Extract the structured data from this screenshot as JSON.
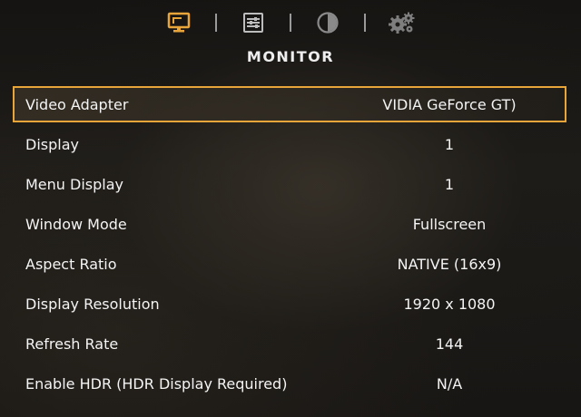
{
  "tabs": [
    {
      "id": "monitor",
      "icon": "monitor-icon",
      "active": true
    },
    {
      "id": "sliders",
      "icon": "sliders-icon",
      "active": false
    },
    {
      "id": "contrast",
      "icon": "contrast-icon",
      "active": false
    },
    {
      "id": "gears",
      "icon": "gears-icon",
      "active": false
    }
  ],
  "colors": {
    "accent": "#e8a63a",
    "inactive_icon": "#8a8a8a",
    "text": "#f4f4f4"
  },
  "page": {
    "title": "MONITOR"
  },
  "settings": [
    {
      "label": "Video Adapter",
      "value": "VIDIA GeForce GT)",
      "selected": true
    },
    {
      "label": "Display",
      "value": "1",
      "selected": false
    },
    {
      "label": "Menu Display",
      "value": "1",
      "selected": false
    },
    {
      "label": "Window Mode",
      "value": "Fullscreen",
      "selected": false
    },
    {
      "label": "Aspect Ratio",
      "value": "NATIVE (16x9)",
      "selected": false
    },
    {
      "label": "Display Resolution",
      "value": "1920 x 1080",
      "selected": false
    },
    {
      "label": "Refresh Rate",
      "value": "144",
      "selected": false
    },
    {
      "label": "Enable HDR (HDR Display Required)",
      "value": "N/A",
      "selected": false
    }
  ]
}
